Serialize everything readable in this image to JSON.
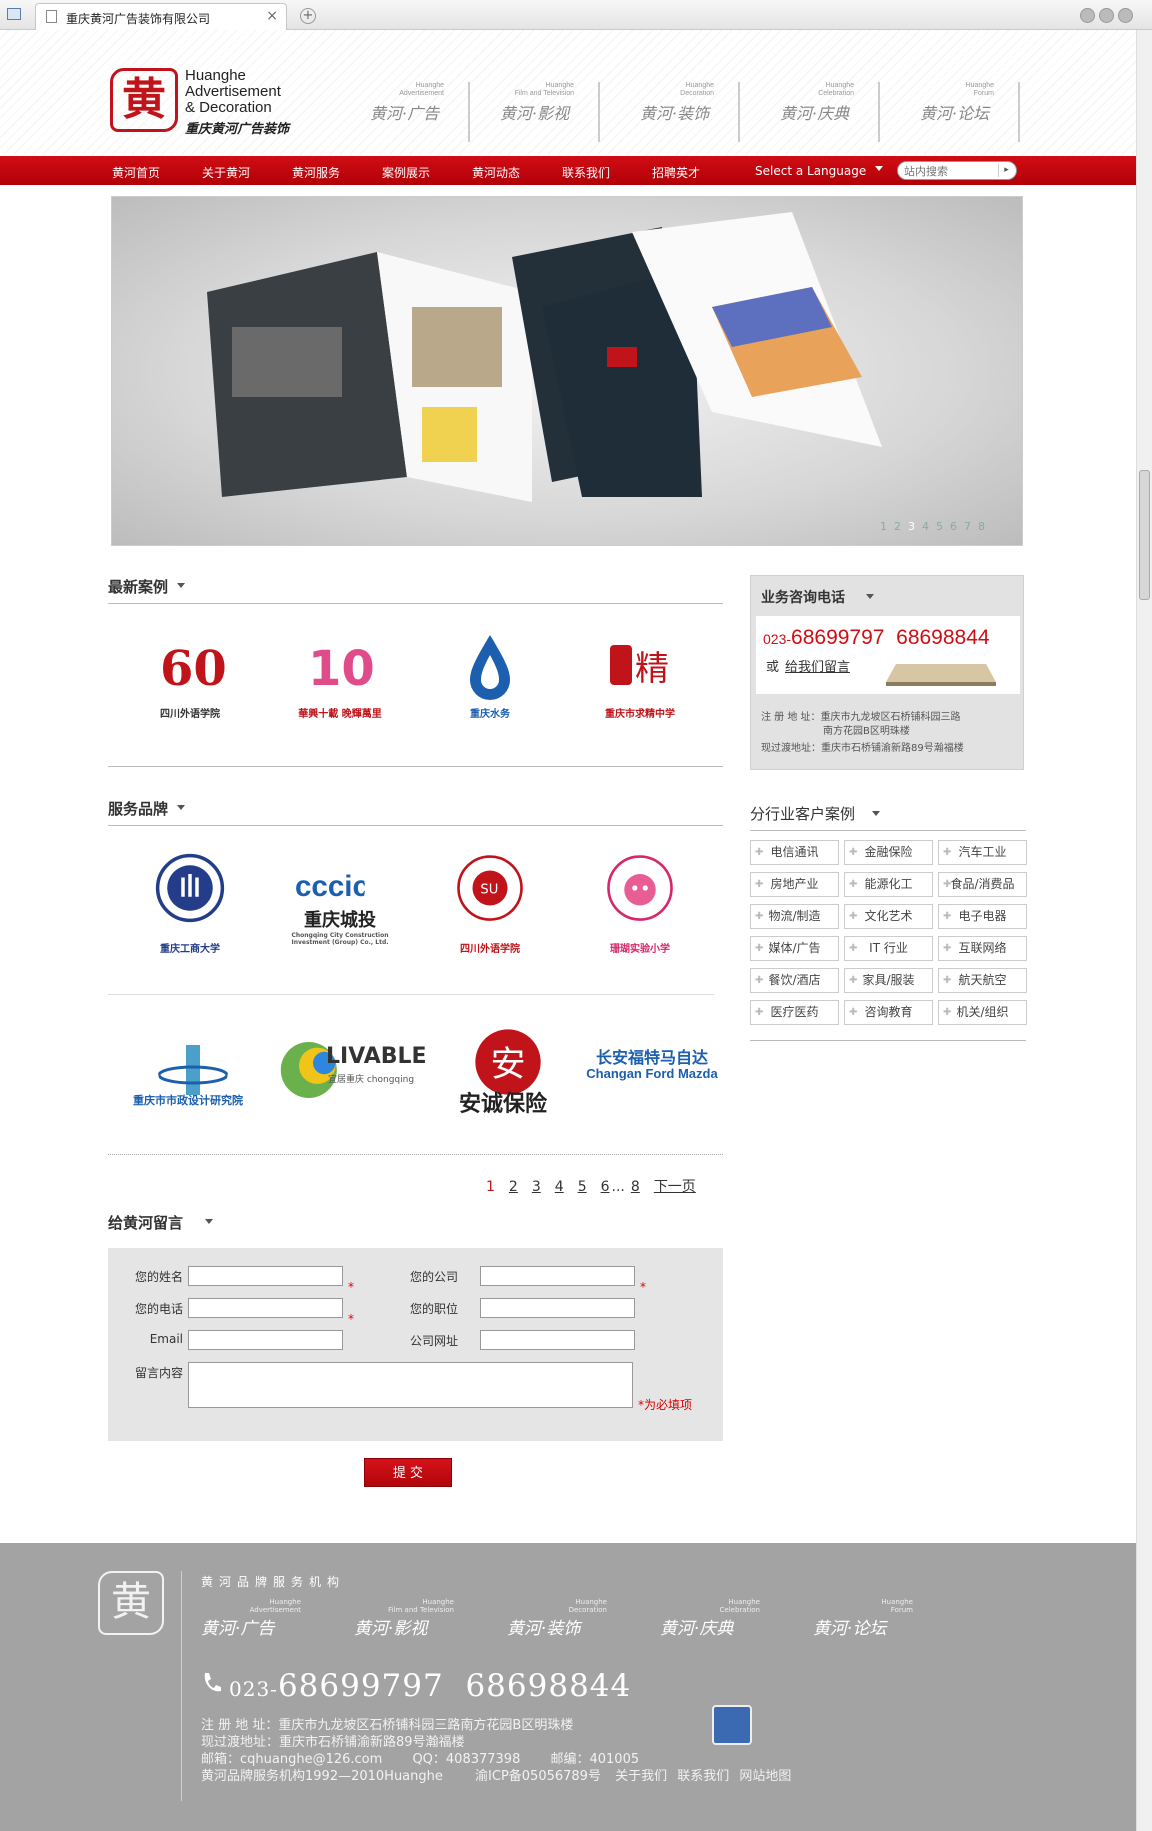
{
  "browser": {
    "tab_title": "重庆黄河广告装饰有限公司",
    "close_glyph": "×",
    "new_tab_glyph": "+"
  },
  "header": {
    "logo_en_1": "Huanghe",
    "logo_en_2": "Advertisement",
    "logo_en_3": "& Decoration",
    "logo_cn": "重庆黄河广告装饰",
    "logo_seal": "黄",
    "subbrands": [
      {
        "en_1": "Huanghe",
        "en_2": "Advertisement",
        "cn": "黄河·广告"
      },
      {
        "en_1": "Huanghe",
        "en_2": "Film and Television",
        "cn": "黄河·影视"
      },
      {
        "en_1": "Huanghe",
        "en_2": "Decoration",
        "cn": "黄河·装饰"
      },
      {
        "en_1": "Huanghe",
        "en_2": "Celebration",
        "cn": "黄河·庆典"
      },
      {
        "en_1": "Huanghe",
        "en_2": "Forum",
        "cn": "黄河·论坛"
      }
    ]
  },
  "nav": {
    "items": [
      "黄河首页",
      "关于黄河",
      "黄河服务",
      "案例展示",
      "黄河动态",
      "联系我们",
      "招聘英才"
    ],
    "language": "Select a Language",
    "search_placeholder": "站内搜索",
    "search_btn": "▸"
  },
  "banner": {
    "pages": [
      "1",
      "2",
      "3",
      "4",
      "5",
      "6",
      "7",
      "8"
    ],
    "active_page": "3"
  },
  "latest_cases": {
    "title": "最新案例",
    "logos": [
      {
        "name": "四川外语学院",
        "color": "#c0141a"
      },
      {
        "name": "華興十載 晚輝萬里",
        "color": "#6aa84f"
      },
      {
        "name": "重庆水务",
        "color": "#1b5fae"
      },
      {
        "name": "重庆市求精中学",
        "color": "#c0141a"
      }
    ]
  },
  "brand_service": {
    "title": "服务品牌",
    "logos_row1": [
      {
        "name": "重庆工商大学",
        "color": "#233d8a"
      },
      {
        "name": "重庆城投",
        "color": "#1b5fae"
      },
      {
        "name": "四川外语学院",
        "color": "#c0141a"
      },
      {
        "name": "珊瑚实验小学",
        "color": "#d6286a"
      }
    ],
    "logos_row2": [
      {
        "name": "重庆市市政设计研究院",
        "color": "#1b5fae"
      },
      {
        "name": "LIVABLE",
        "color": "#333333"
      },
      {
        "name": "安诚保险",
        "color": "#c0141a"
      },
      {
        "name": "长安福特马自达",
        "color": "#1b5fae"
      }
    ],
    "livable_sub": "宜居重庆 chongqing",
    "cccic_sub": "Chongqing City Construction Investment (Group) Co., Ltd.",
    "changan_en": "Changan Ford Mazda"
  },
  "pagination": {
    "pages": [
      "1",
      "2",
      "3",
      "4",
      "5",
      "6"
    ],
    "ellipsis": "...",
    "last": "8",
    "next": "下一页"
  },
  "message_form": {
    "title": "给黄河留言",
    "name_label": "您的姓名",
    "company_label": "您的公司",
    "phone_label": "您的电话",
    "position_label": "您的职位",
    "email_label": "Email",
    "website_label": "公司网址",
    "content_label": "留言内容",
    "required_mark": "*",
    "required_note": "*为必填项",
    "submit": "提 交"
  },
  "consult": {
    "title": "业务咨询电话",
    "phone_area": "023-",
    "phone_1": "68699797",
    "phone_2": "68698844",
    "or": "或",
    "leave_msg": "给我们留言",
    "reg_addr_label": "注 册 地 址：",
    "reg_addr_1": "重庆市九龙坡区石桥铺科园三路",
    "reg_addr_2": "南方花园B区明珠楼",
    "cur_addr_label": "现过渡地址：",
    "cur_addr": "重庆市石桥铺渝新路89号瀚福楼"
  },
  "industry": {
    "title": "分行业客户案例",
    "items": [
      "电信通讯",
      "金融保险",
      "汽车工业",
      "房地产业",
      "能源化工",
      "食品/消费品",
      "物流/制造",
      "文化艺术",
      "电子电器",
      "媒体/广告",
      "IT 行业",
      "互联网络",
      "餐饮/酒店",
      "家具/服装",
      "航天航空",
      "医疗医药",
      "咨询教育",
      "机关/组织"
    ]
  },
  "footer": {
    "seal": "黄",
    "brand_title": "黄河品牌服务机构",
    "subbrands": [
      {
        "en_1": "Huanghe",
        "en_2": "Advertisement",
        "cn": "黄河·广告"
      },
      {
        "en_1": "Huanghe",
        "en_2": "Film and Television",
        "cn": "黄河·影视"
      },
      {
        "en_1": "Huanghe",
        "en_2": "Decoration",
        "cn": "黄河·装饰"
      },
      {
        "en_1": "Huanghe",
        "en_2": "Celebration",
        "cn": "黄河·庆典"
      },
      {
        "en_1": "Huanghe",
        "en_2": "Forum",
        "cn": "黄河·论坛"
      }
    ],
    "phone_area": "023-",
    "phone_1": "68699797",
    "phone_2": "68698844",
    "reg_addr": "注 册 地 址：重庆市九龙坡区石桥铺科园三路南方花园B区明珠楼",
    "cur_addr": "现过渡地址：重庆市石桥铺渝新路89号瀚福楼",
    "email": "邮箱：cqhuanghe@126.com",
    "qq": "QQ：408377398",
    "postcode": "邮编：401005",
    "copyright": "黄河品牌服务机构1992—2010Huanghe",
    "icp": "渝ICP备05056789号",
    "about": "关于我们",
    "contact": "联系我们",
    "sitemap": "网站地图"
  }
}
